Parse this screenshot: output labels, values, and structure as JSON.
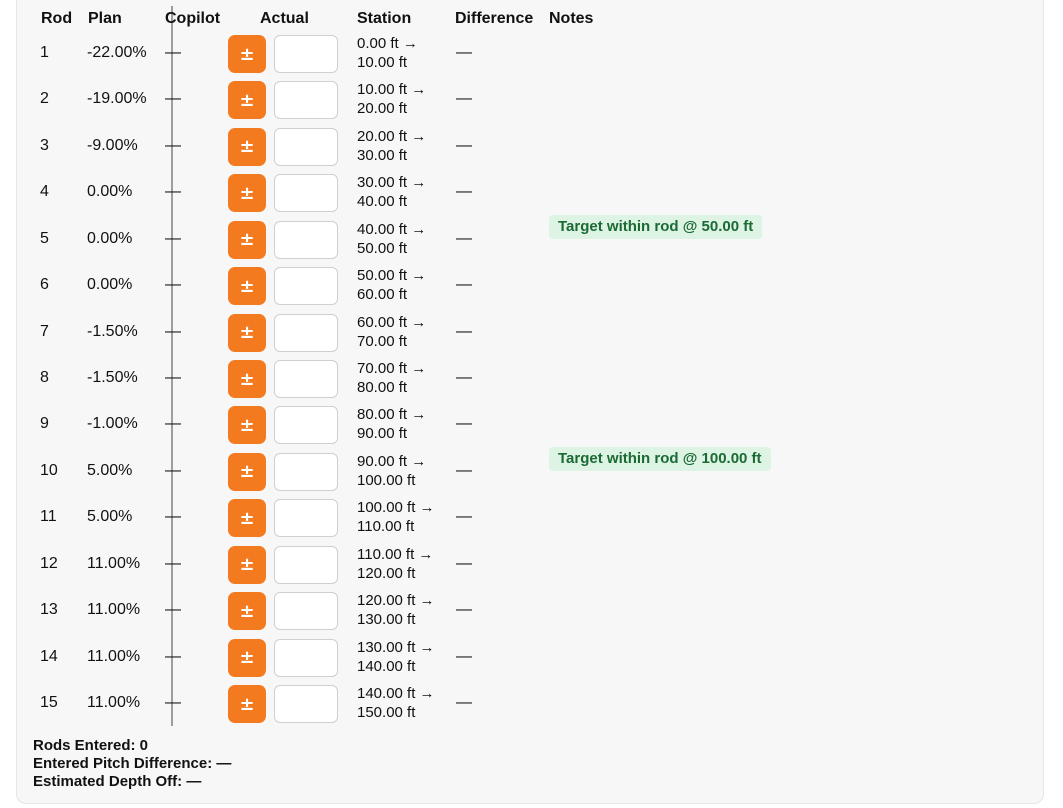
{
  "headers": {
    "rod": "Rod",
    "plan": "Plan",
    "copilot": "Copilot",
    "actual": "Actual",
    "station": "Station",
    "difference": "Difference",
    "notes": "Notes"
  },
  "button_label": "±",
  "rows": [
    {
      "rod": "1",
      "plan": "-22.00%",
      "copilot": "—",
      "actual": "",
      "station_start": "0.00 ft →",
      "station_end": "10.00 ft",
      "difference": "—",
      "note": ""
    },
    {
      "rod": "2",
      "plan": "-19.00%",
      "copilot": "—",
      "actual": "",
      "station_start": "10.00 ft →",
      "station_end": "20.00 ft",
      "difference": "—",
      "note": ""
    },
    {
      "rod": "3",
      "plan": "-9.00%",
      "copilot": "—",
      "actual": "",
      "station_start": "20.00 ft →",
      "station_end": "30.00 ft",
      "difference": "—",
      "note": ""
    },
    {
      "rod": "4",
      "plan": "0.00%",
      "copilot": "—",
      "actual": "",
      "station_start": "30.00 ft →",
      "station_end": "40.00 ft",
      "difference": "—",
      "note": ""
    },
    {
      "rod": "5",
      "plan": "0.00%",
      "copilot": "—",
      "actual": "",
      "station_start": "40.00 ft →",
      "station_end": "50.00 ft",
      "difference": "—",
      "note": "Target within rod @ 50.00 ft"
    },
    {
      "rod": "6",
      "plan": "0.00%",
      "copilot": "—",
      "actual": "",
      "station_start": "50.00 ft →",
      "station_end": "60.00 ft",
      "difference": "—",
      "note": ""
    },
    {
      "rod": "7",
      "plan": "-1.50%",
      "copilot": "—",
      "actual": "",
      "station_start": "60.00 ft →",
      "station_end": "70.00 ft",
      "difference": "—",
      "note": ""
    },
    {
      "rod": "8",
      "plan": "-1.50%",
      "copilot": "—",
      "actual": "",
      "station_start": "70.00 ft →",
      "station_end": "80.00 ft",
      "difference": "—",
      "note": ""
    },
    {
      "rod": "9",
      "plan": "-1.00%",
      "copilot": "—",
      "actual": "",
      "station_start": "80.00 ft →",
      "station_end": "90.00 ft",
      "difference": "—",
      "note": ""
    },
    {
      "rod": "10",
      "plan": "5.00%",
      "copilot": "—",
      "actual": "",
      "station_start": "90.00 ft →",
      "station_end": "100.00 ft",
      "difference": "—",
      "note": "Target within rod @ 100.00 ft"
    },
    {
      "rod": "11",
      "plan": "5.00%",
      "copilot": "—",
      "actual": "",
      "station_start": "100.00 ft →",
      "station_end": "110.00 ft",
      "difference": "—",
      "note": ""
    },
    {
      "rod": "12",
      "plan": "11.00%",
      "copilot": "—",
      "actual": "",
      "station_start": "110.00 ft →",
      "station_end": "120.00 ft",
      "difference": "—",
      "note": ""
    },
    {
      "rod": "13",
      "plan": "11.00%",
      "copilot": "—",
      "actual": "",
      "station_start": "120.00 ft →",
      "station_end": "130.00 ft",
      "difference": "—",
      "note": ""
    },
    {
      "rod": "14",
      "plan": "11.00%",
      "copilot": "—",
      "actual": "",
      "station_start": "130.00 ft →",
      "station_end": "140.00 ft",
      "difference": "—",
      "note": ""
    },
    {
      "rod": "15",
      "plan": "11.00%",
      "copilot": "—",
      "actual": "",
      "station_start": "140.00 ft →",
      "station_end": "150.00 ft",
      "difference": "—",
      "note": ""
    }
  ],
  "summary": {
    "rods_entered": "Rods Entered: 0",
    "pitch_difference": "Entered Pitch Difference: —",
    "depth_off": "Estimated Depth Off: —"
  },
  "colors": {
    "accent": "#f47a1f",
    "note_bg": "#ddf3e4",
    "note_text": "#1b6a34"
  }
}
